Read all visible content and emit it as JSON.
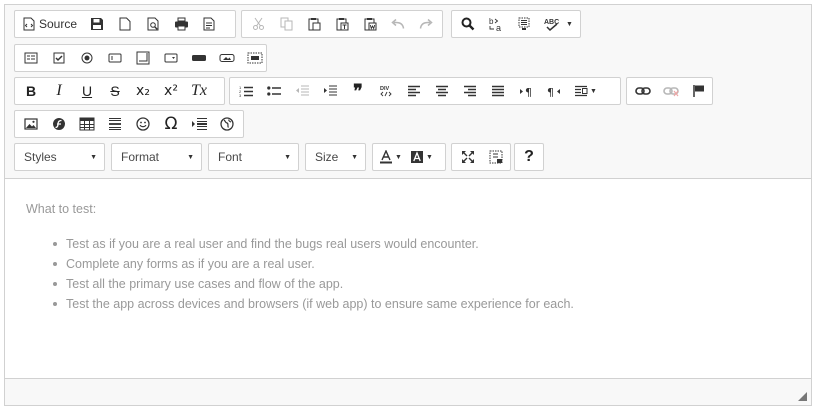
{
  "toolbar": {
    "source_label": "Source",
    "styles_label": "Styles",
    "format_label": "Format",
    "font_label": "Font",
    "size_label": "Size",
    "help_label": "?",
    "bold_label": "B",
    "italic_label": "I",
    "underline_label": "U",
    "strike_label": "S",
    "subscript_label": "x₂",
    "superscript_label": "x²",
    "removeformat_label": "Tx",
    "blockquote_label": "❞",
    "omega_label": "Ω",
    "spellcheck_label": "ABC"
  },
  "content": {
    "heading": "What to test:",
    "items": [
      "Test as if you are a real user and find the bugs real users would encounter.",
      "Complete any forms as if you are a real user.",
      "Test all the primary use cases and flow of the app.",
      "Test the app across devices and browsers (if web app) to ensure same experience for each."
    ]
  },
  "colors": {
    "toolbar_bg": "#f8f8f8",
    "border": "#d1d1d1",
    "content_text": "#999999",
    "icon": "#333333"
  }
}
